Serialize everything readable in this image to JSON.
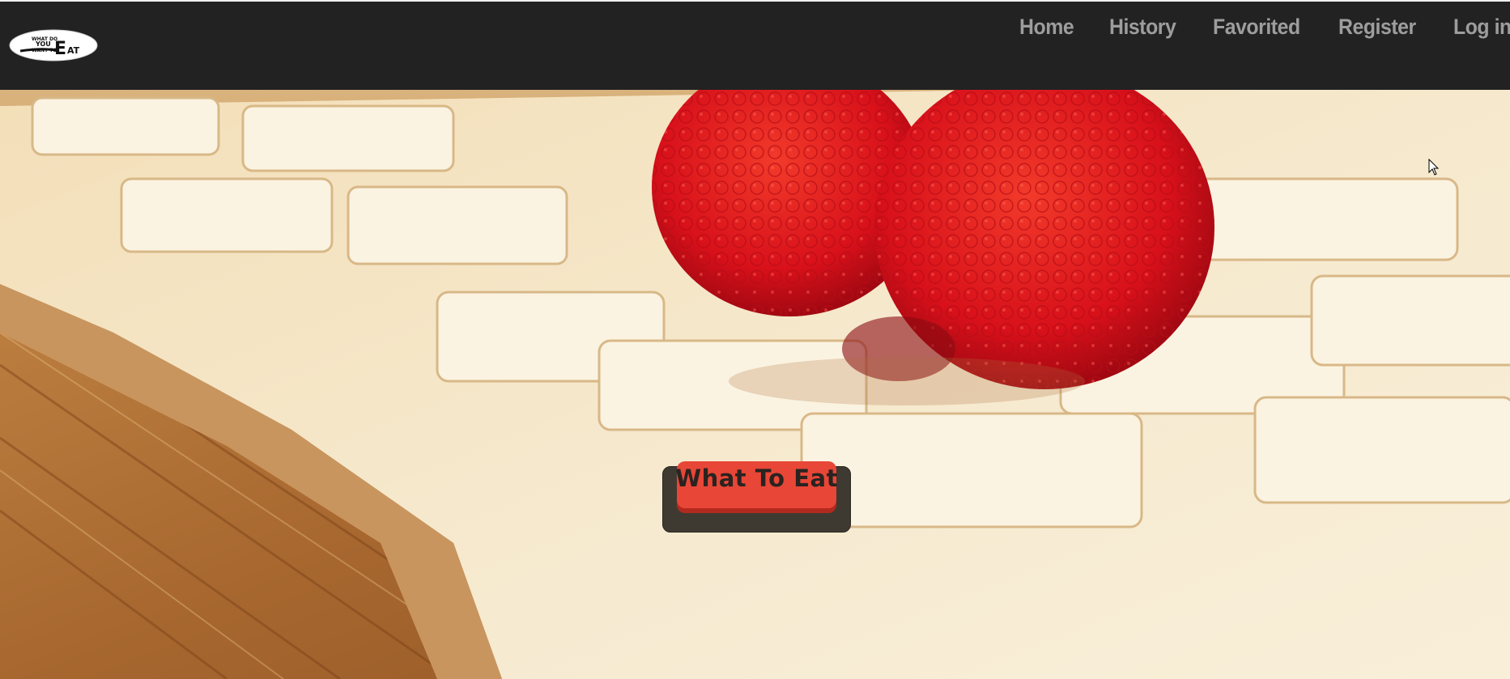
{
  "navbar": {
    "logo_alt": "What Do You Want To Eat",
    "links": [
      {
        "label": "Home"
      },
      {
        "label": "History"
      },
      {
        "label": "Favorited"
      },
      {
        "label": "Register"
      },
      {
        "label": "Log in"
      }
    ]
  },
  "hero": {
    "cta_label": "What To Eat"
  },
  "colors": {
    "navbar_bg": "#222222",
    "nav_link": "#9d9d9d",
    "cta_red": "#e84637",
    "cta_base": "#3f3a31"
  }
}
